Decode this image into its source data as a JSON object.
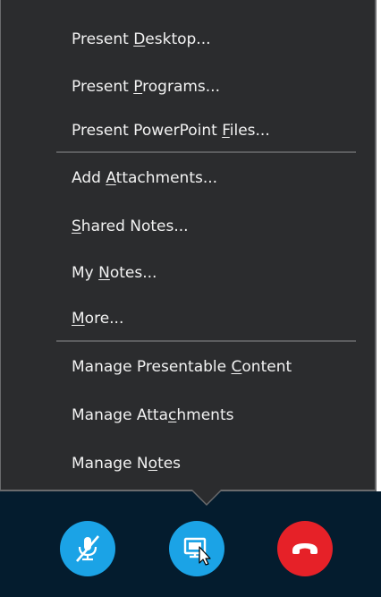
{
  "menu": {
    "items": [
      {
        "prefix": "Present ",
        "mnemonic": "D",
        "suffix": "esktop..."
      },
      {
        "prefix": "Present ",
        "mnemonic": "P",
        "suffix": "rograms..."
      },
      {
        "prefix": "Present PowerPoint ",
        "mnemonic": "F",
        "suffix": "iles..."
      },
      {
        "prefix": "Add ",
        "mnemonic": "A",
        "suffix": "ttachments..."
      },
      {
        "prefix": "",
        "mnemonic": "S",
        "suffix": "hared Notes..."
      },
      {
        "prefix": "My ",
        "mnemonic": "N",
        "suffix": "otes..."
      },
      {
        "prefix": "",
        "mnemonic": "M",
        "suffix": "ore..."
      },
      {
        "prefix": "Manage Presentable ",
        "mnemonic": "C",
        "suffix": "ontent"
      },
      {
        "prefix": "Manage Atta",
        "mnemonic": "c",
        "suffix": "hments"
      },
      {
        "prefix": "Manage N",
        "mnemonic": "o",
        "suffix": "tes"
      }
    ]
  },
  "toolbar": {
    "mic_button": {
      "icon": "microphone-muted-icon",
      "color": "#1ba3e6"
    },
    "present_button": {
      "icon": "present-content-icon",
      "color": "#1ba3e6"
    },
    "hangup_button": {
      "icon": "hang-up-icon",
      "color": "#e62128"
    }
  },
  "colors": {
    "menu_bg": "#2b2c2e",
    "menu_text": "#f2f2f2",
    "toolbar_bg": "#041c2e"
  }
}
